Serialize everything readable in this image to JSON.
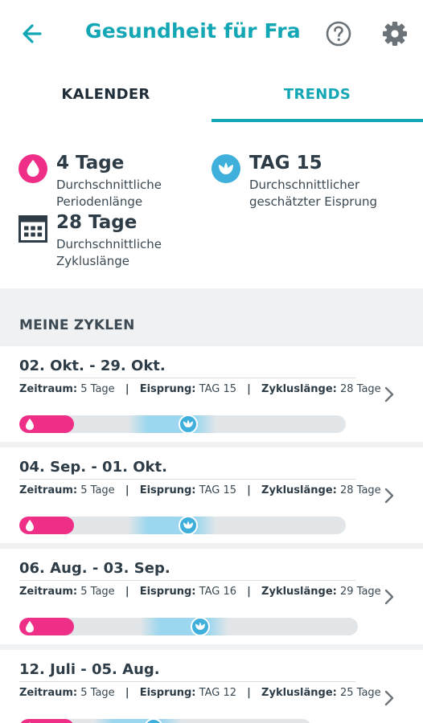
{
  "header": {
    "title": "Gesundheit für Fra...",
    "back_icon": "arrow-left-icon",
    "help_icon": "help-circle-icon",
    "settings_icon": "gear-icon"
  },
  "tabs": [
    {
      "label": "KALENDER",
      "active": false
    },
    {
      "label": "TRENDS",
      "active": true
    }
  ],
  "summary": {
    "period": {
      "value": "4 Tage",
      "label": "Durchschnittliche Periodenlänge",
      "icon": "drop-icon"
    },
    "ovulation": {
      "value": "TAG 15",
      "label": "Durchschnittlicher geschätzter Eisprung",
      "icon": "lotus-icon"
    },
    "cycle": {
      "value": "28 Tage",
      "label": "Durchschnittliche Zykluslänge",
      "icon": "calendar-icon"
    }
  },
  "cycles_section": {
    "title": "MEINE ZYKLEN"
  },
  "meta_labels": {
    "zeitraum": "Zeitraum:",
    "eisprung": "Eisprung:",
    "zykluslaenge": "Zykluslänge:",
    "sep": "|"
  },
  "cycles": [
    {
      "date": "02. Okt. - 29. Okt.",
      "zeitraum": "5 Tage",
      "eisprung": "TAG 15",
      "zykluslaenge": "28 Tage",
      "period_days": 5,
      "ovulation_day": 15,
      "length_days": 28
    },
    {
      "date": "04. Sep. - 01. Okt.",
      "zeitraum": "5 Tage",
      "eisprung": "TAG 15",
      "zykluslaenge": "28 Tage",
      "period_days": 5,
      "ovulation_day": 15,
      "length_days": 28
    },
    {
      "date": "06. Aug. - 03. Sep.",
      "zeitraum": "5 Tage",
      "eisprung": "TAG 16",
      "zykluslaenge": "29 Tage",
      "period_days": 5,
      "ovulation_day": 16,
      "length_days": 29
    },
    {
      "date": "12. Juli - 05. Aug.",
      "zeitraum": "5 Tage",
      "eisprung": "TAG 12",
      "zykluslaenge": "25 Tage",
      "period_days": 5,
      "ovulation_day": 12,
      "length_days": 25
    }
  ],
  "colors": {
    "accent": "#13a7b6",
    "period": "#ef2f87",
    "ovulation": "#3fb0dc",
    "fertile": "#9dd7ef"
  }
}
